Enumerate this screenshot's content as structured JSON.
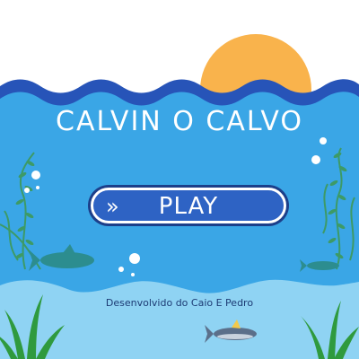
{
  "game": {
    "title": "CALVIN O CALVO",
    "play_label": "PLAY",
    "play_icon": "»",
    "credits": "Desenvolvido do Caio E Pedro"
  },
  "colors": {
    "sky": "#ffffff",
    "sun": "#f9b34c",
    "wave_dark": "#2754b8",
    "water": "#3aa6e6",
    "water_light": "#8fd3f3",
    "button": "#2e63c4",
    "seaweed": "#3d9a66",
    "fish": "#2c8d8f",
    "credits_text": "#1d3b74"
  },
  "icons": [
    "sun-icon",
    "seaweed-icon",
    "fish-icon",
    "tuna-icon",
    "bubble-icon",
    "chevron-right-icon"
  ]
}
